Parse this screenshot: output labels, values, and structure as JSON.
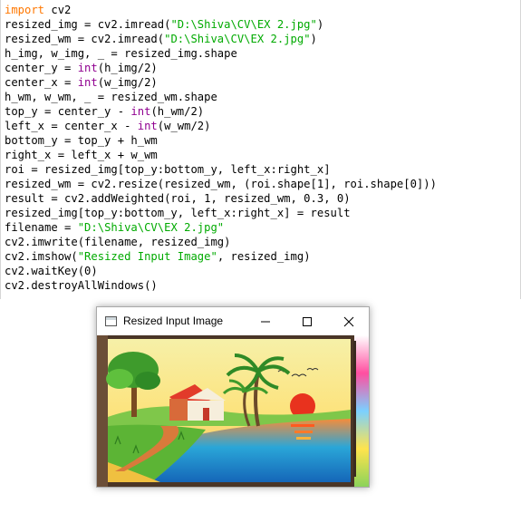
{
  "code_lines": [
    [
      {
        "t": "import",
        "c": "kw"
      },
      {
        "t": " cv2"
      }
    ],
    [
      {
        "t": "resized_img = cv2.imread("
      },
      {
        "t": "\"D:\\Shiva\\CV\\EX 2.jpg\"",
        "c": "st"
      },
      {
        "t": ")"
      }
    ],
    [
      {
        "t": "resized_wm = cv2.imread("
      },
      {
        "t": "\"D:\\Shiva\\CV\\EX 2.jpg\"",
        "c": "st"
      },
      {
        "t": ")"
      }
    ],
    [
      {
        "t": "h_img, w_img, _ = resized_img.shape"
      }
    ],
    [
      {
        "t": "center_y = "
      },
      {
        "t": "int",
        "c": "bi"
      },
      {
        "t": "(h_img/2)"
      }
    ],
    [
      {
        "t": "center_x = "
      },
      {
        "t": "int",
        "c": "bi"
      },
      {
        "t": "(w_img/2)"
      }
    ],
    [
      {
        "t": "h_wm, w_wm, _ = resized_wm.shape"
      }
    ],
    [
      {
        "t": "top_y = center_y - "
      },
      {
        "t": "int",
        "c": "bi"
      },
      {
        "t": "(h_wm/2)"
      }
    ],
    [
      {
        "t": "left_x = center_x - "
      },
      {
        "t": "int",
        "c": "bi"
      },
      {
        "t": "(w_wm/2)"
      }
    ],
    [
      {
        "t": "bottom_y = top_y + h_wm"
      }
    ],
    [
      {
        "t": "right_x = left_x + w_wm"
      }
    ],
    [
      {
        "t": "roi = resized_img[top_y:bottom_y, left_x:right_x]"
      }
    ],
    [
      {
        "t": "resized_wm = cv2.resize(resized_wm, (roi.shape[1], roi.shape[0]))"
      }
    ],
    [
      {
        "t": "result = cv2.addWeighted(roi, 1, resized_wm, 0.3, 0)"
      }
    ],
    [
      {
        "t": "resized_img[top_y:bottom_y, left_x:right_x] = result"
      }
    ],
    [
      {
        "t": "filename = "
      },
      {
        "t": "\"D:\\Shiva\\CV\\EX 2.jpg\"",
        "c": "st"
      }
    ],
    [
      {
        "t": "cv2.imwrite(filename, resized_img)"
      }
    ],
    [
      {
        "t": "cv2.imshow("
      },
      {
        "t": "\"Resized Input Image\"",
        "c": "st"
      },
      {
        "t": ", resized_img)"
      }
    ],
    [
      {
        "t": "cv2.waitKey(0)"
      }
    ],
    [
      {
        "t": "cv2.destroyAllWindows()"
      }
    ]
  ],
  "colors": {
    "keyword": "#ff7700",
    "builtin": "#900090",
    "string": "#00aa00"
  },
  "window": {
    "title": "Resized Input Image",
    "icon": "window-app-icon",
    "controls": {
      "minimize": "minimize-icon",
      "maximize": "maximize-icon",
      "close": "close-icon"
    },
    "image_subject": "landscape-drawing"
  }
}
